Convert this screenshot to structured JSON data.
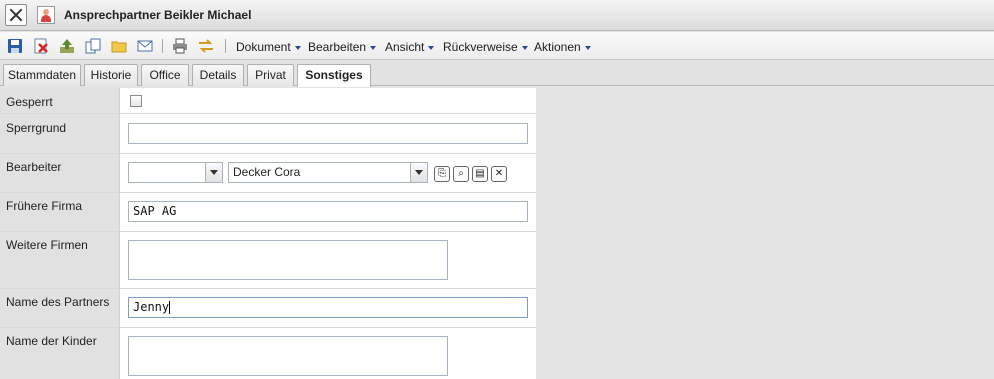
{
  "window": {
    "title": "Ansprechpartner Beikler Michael"
  },
  "toolbar": {
    "icons": [
      "save-icon",
      "delete-icon",
      "upload-icon",
      "copy-icon",
      "folder-icon",
      "mail-icon",
      "print-icon",
      "swap-icon"
    ],
    "menus": [
      "Dokument",
      "Bearbeiten",
      "Ansicht",
      "Rückverweise",
      "Aktionen"
    ]
  },
  "tabs": [
    "Stammdaten",
    "Historie",
    "Office",
    "Details",
    "Privat",
    "Sonstiges"
  ],
  "active_tab": "Sonstiges",
  "form": {
    "gesperrt": {
      "label": "Gesperrt",
      "checked": false
    },
    "sperrgrund": {
      "label": "Sperrgrund",
      "value": ""
    },
    "bearbeiter": {
      "label": "Bearbeiter",
      "select1": "",
      "select2": "Decker Cora"
    },
    "fruehere_firma": {
      "label": "Frühere Firma",
      "value": "SAP AG"
    },
    "weitere_firmen": {
      "label": "Weitere Firmen",
      "value": ""
    },
    "name_partner": {
      "label": "Name des Partners",
      "value": "Jenny"
    },
    "name_kinder": {
      "label": "Name der Kinder",
      "value": ""
    }
  }
}
